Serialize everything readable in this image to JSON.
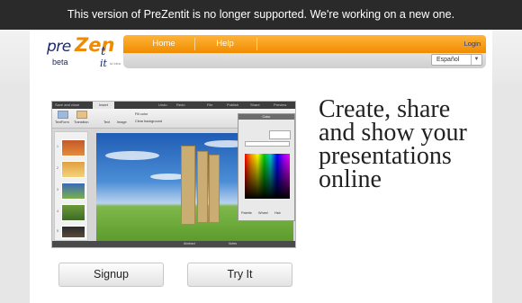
{
  "notice": "This version of PreZentit is no longer supported. We're working on a new one.",
  "logo": {
    "pre": "pre",
    "zen": "Zen",
    "it": "t",
    "beta": "beta",
    "it2": "it",
    "tagline": "ta idea"
  },
  "nav": {
    "home": "Home",
    "help": "Help",
    "login": "Login"
  },
  "language": {
    "selected": "Español"
  },
  "headline": "Create, share and show your presentations online",
  "buttons": {
    "signup": "Signup",
    "try": "Try It"
  },
  "screenshot": {
    "menu": [
      "Save and close",
      "Insert",
      "Undo",
      "Redo",
      "File",
      "Publish",
      "Share",
      "Preview"
    ],
    "ribbon": [
      "TextForm",
      "Transition",
      "Text",
      "Image",
      "Fill color",
      "Clear background"
    ],
    "color_panel": {
      "title": "Color",
      "tabs": [
        "Palette",
        "Wheel",
        "Hsb"
      ]
    },
    "status": {
      "abstract": "Abstract",
      "notes": "Notes"
    },
    "slide_numbers": [
      "1",
      "2",
      "3",
      "4",
      "5"
    ]
  },
  "colors": {
    "accent": "#f08c00",
    "notice_bg": "#2a2a2a"
  }
}
